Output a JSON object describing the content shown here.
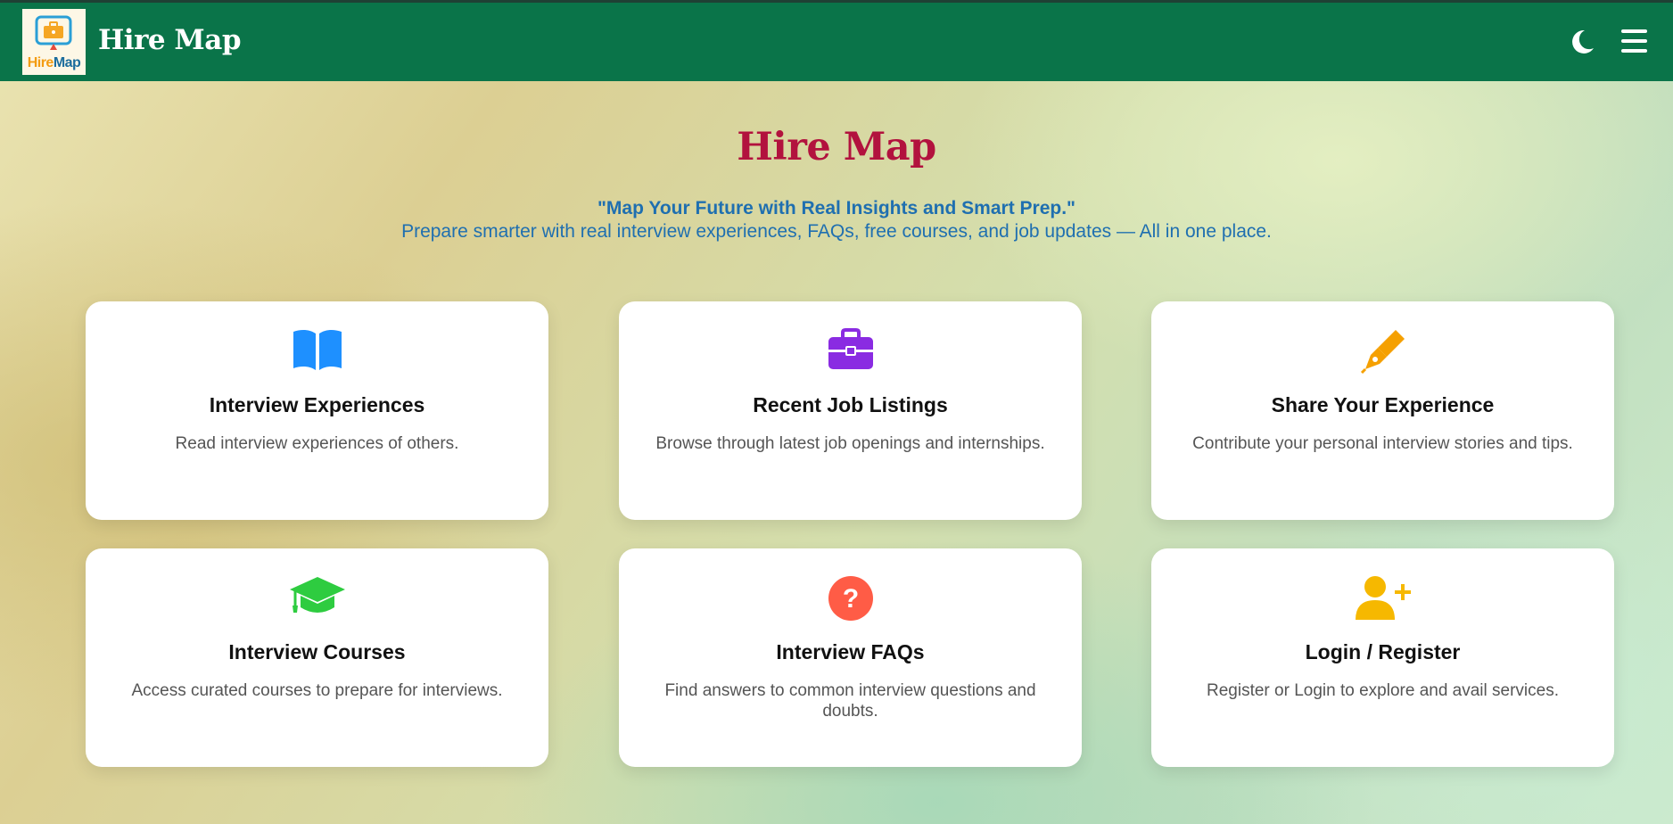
{
  "header": {
    "logo_text_part1": "Hire",
    "logo_text_part2": "Map",
    "brand": "Hire Map",
    "theme_toggle_icon": "moon-icon",
    "menu_icon": "hamburger-menu-icon"
  },
  "hero": {
    "title": "Hire Map",
    "tagline": "\"Map Your Future with Real Insights and Smart Prep.\"",
    "subtitle": "Prepare smarter with real interview experiences, FAQs, free courses, and job updates — All in one place."
  },
  "cards": [
    {
      "title": "Interview Experiences",
      "description": "Read interview experiences of others.",
      "icon": "book-icon",
      "color": "#1e90ff"
    },
    {
      "title": "Recent Job Listings",
      "description": "Browse through latest job openings and internships.",
      "icon": "briefcase-icon",
      "color": "#8a2be2"
    },
    {
      "title": "Share Your Experience",
      "description": "Contribute your personal interview stories and tips.",
      "icon": "pen-icon",
      "color": "#f5a000"
    },
    {
      "title": "Interview Courses",
      "description": "Access curated courses to prepare for interviews.",
      "icon": "graduation-cap-icon",
      "color": "#2ecc40"
    },
    {
      "title": "Interview FAQs",
      "description": "Find answers to common interview questions and doubts.",
      "icon": "question-circle-icon",
      "color": "#ff5c46"
    },
    {
      "title": "Login / Register",
      "description": "Register or Login to explore and avail services.",
      "icon": "user-plus-icon",
      "color": "#f6b800"
    }
  ],
  "colors": {
    "topbar": "#0a7449",
    "hero_title": "#b2123e",
    "tagline": "#1f6fb0"
  }
}
